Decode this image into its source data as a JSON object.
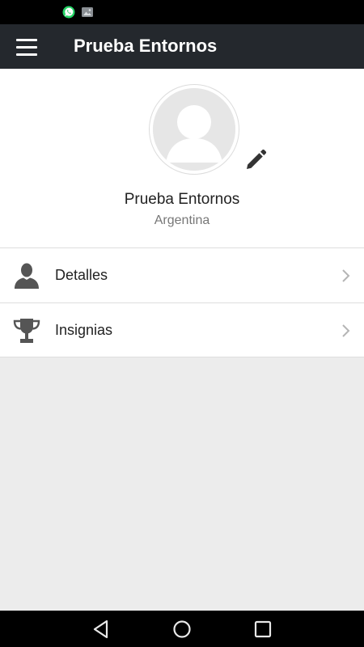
{
  "status_bar": {
    "icons": [
      "whatsapp-icon",
      "image-icon"
    ]
  },
  "app_bar": {
    "title": "Prueba Entornos",
    "menu_icon": "hamburger-menu-icon"
  },
  "profile": {
    "name": "Prueba Entornos",
    "country": "Argentina",
    "avatar_icon": "default-avatar-icon",
    "edit_icon": "pencil-icon"
  },
  "menu_items": [
    {
      "label": "Detalles",
      "icon": "person-icon"
    },
    {
      "label": "Insignias",
      "icon": "trophy-icon"
    }
  ],
  "nav_bar": {
    "icons": [
      "back-triangle-icon",
      "home-circle-icon",
      "recent-square-icon"
    ]
  },
  "colors": {
    "app_bar": "#24282d",
    "background": "#ececec",
    "icon_gray": "#555555"
  }
}
